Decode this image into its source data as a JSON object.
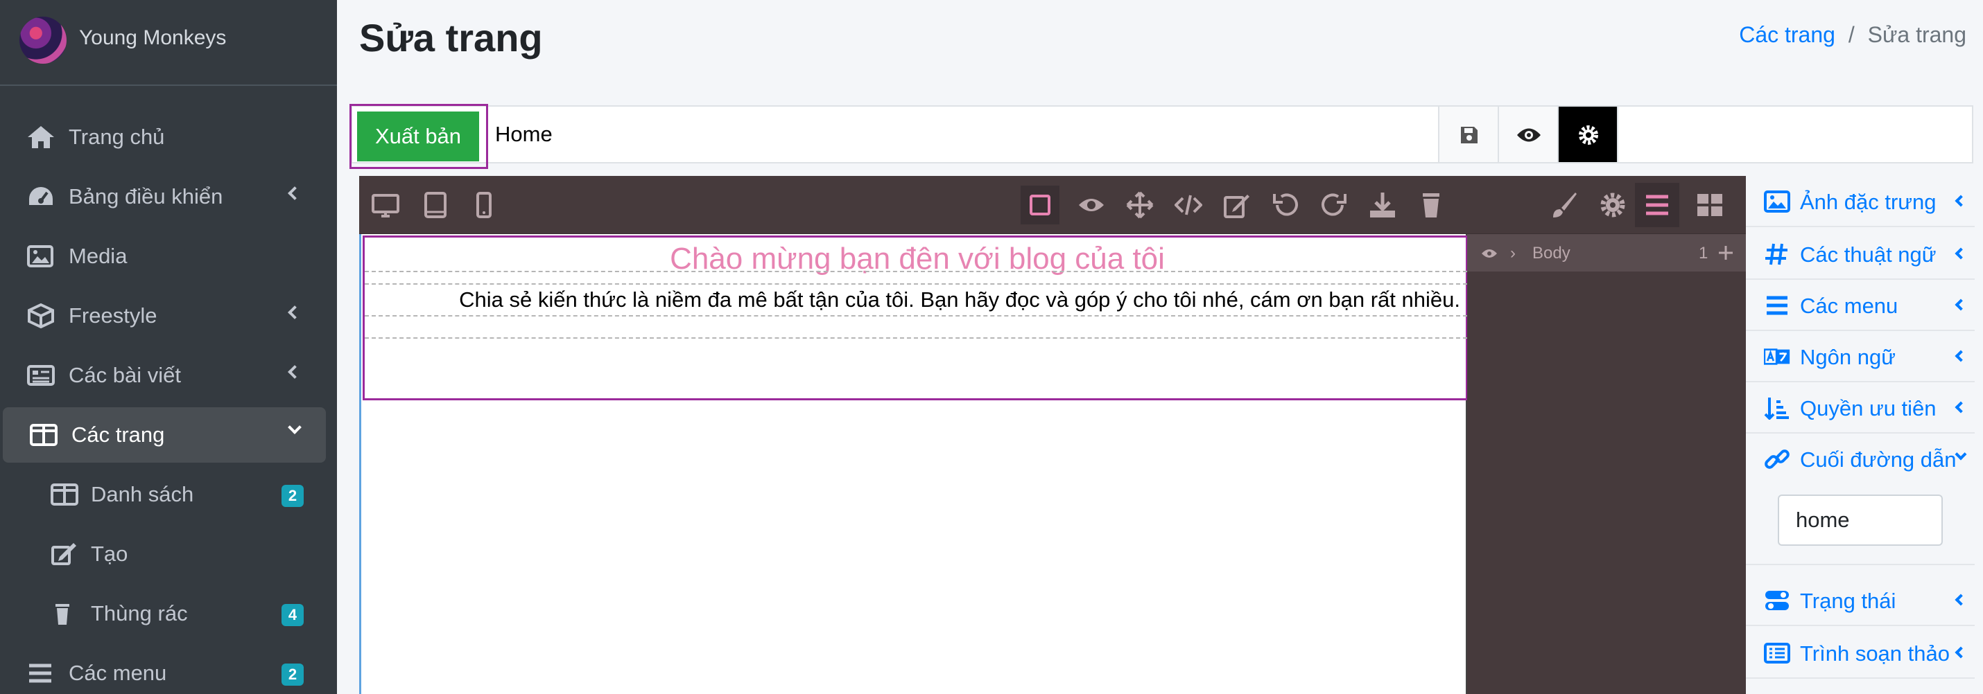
{
  "sidebar": {
    "brand": "Young Monkeys",
    "items": [
      {
        "label": "Trang chủ",
        "icon": "home-icon"
      },
      {
        "label": "Bảng điều khiển",
        "icon": "dashboard-icon"
      },
      {
        "label": "Media",
        "icon": "image-icon"
      },
      {
        "label": "Freestyle",
        "icon": "cube-icon"
      },
      {
        "label": "Các bài viết",
        "icon": "newspaper-icon"
      },
      {
        "label": "Các trang",
        "icon": "columns-icon"
      },
      {
        "label": "Danh sách",
        "icon": "columns-icon",
        "badge": "2"
      },
      {
        "label": "Tạo",
        "icon": "edit-icon"
      },
      {
        "label": "Thùng rác",
        "icon": "trash-icon",
        "badge": "4"
      },
      {
        "label": "Các menu",
        "icon": "bars-icon",
        "badge": "2"
      }
    ]
  },
  "header": {
    "title": "Sửa trang",
    "breadcrumb": {
      "link": "Các trang",
      "separator": "/",
      "current": "Sửa trang"
    }
  },
  "top_toolbar": {
    "publish_label": "Xuất bản",
    "page_title_value": "Home"
  },
  "canvas": {
    "heading": "Chào mừng bạn đên với blog của tôi",
    "subtext": "Chia sẻ kiến thức là niềm đa mê bất tận của tôi. Bạn hãy đọc và góp ý cho tôi nhé, cám ơn bạn rất nhiều."
  },
  "layers": {
    "row_label": "Body",
    "row_count": "1"
  },
  "right_panel": {
    "items": [
      {
        "label": "Ảnh đặc trưng",
        "icon": "image-icon"
      },
      {
        "label": "Các thuật ngữ",
        "icon": "hashtag-icon"
      },
      {
        "label": "Các menu",
        "icon": "bars-icon"
      },
      {
        "label": "Ngôn ngữ",
        "icon": "language-icon"
      },
      {
        "label": "Quyền ưu tiên",
        "icon": "sort-icon"
      },
      {
        "label": "Cuối đường dẫn",
        "icon": "link-icon"
      },
      {
        "label": "Trạng thái",
        "icon": "toggle-icon"
      },
      {
        "label": "Trình soạn thảo",
        "icon": "list-icon"
      }
    ],
    "slug_value": "home"
  },
  "colors": {
    "sidebar_bg": "#343a40",
    "accent_blue": "#007bff",
    "publish_green": "#28a745",
    "badge_teal": "#17a2b8",
    "editor_bg": "#463a3c",
    "heading_pink": "#e784b2",
    "selection_purple": "#9b2a9b"
  }
}
